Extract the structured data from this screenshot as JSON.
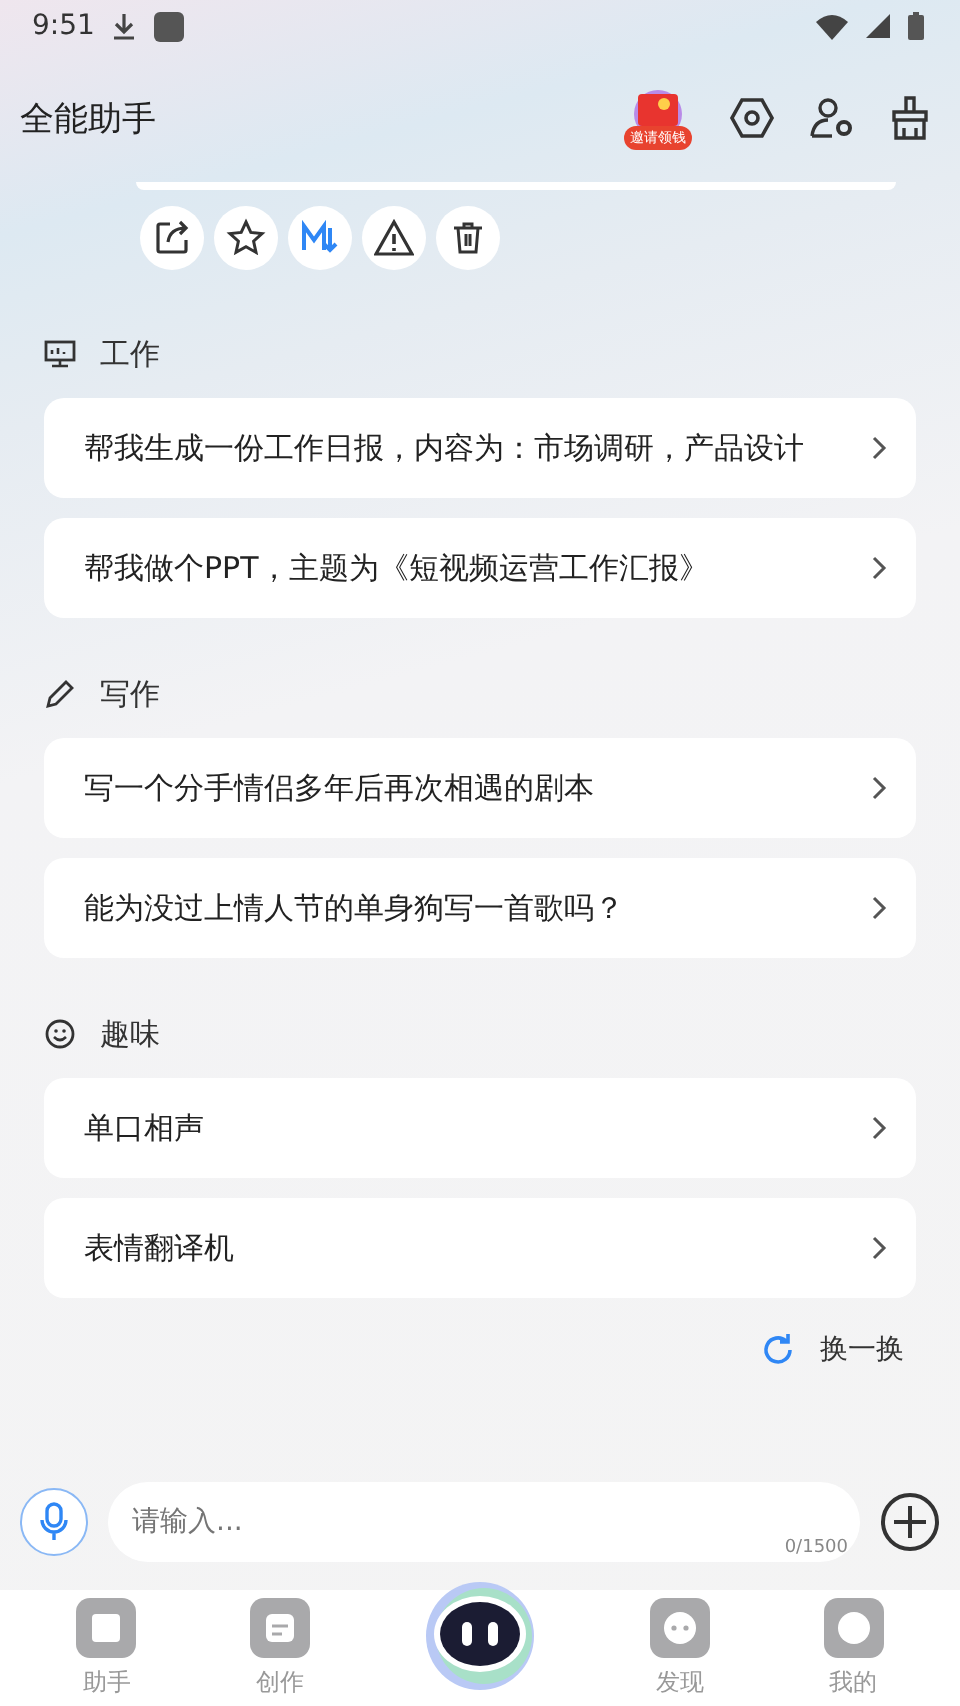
{
  "status_bar": {
    "time": "9:51"
  },
  "header": {
    "title": "全能助手",
    "badge": "邀请领钱"
  },
  "sections": [
    {
      "kind": "monitor",
      "title": "工作",
      "prompts": [
        "帮我生成一份工作日报，内容为：市场调研，产品设计",
        "帮我做个PPT，主题为《短视频运营工作汇报》"
      ]
    },
    {
      "kind": "pencil",
      "title": "写作",
      "prompts": [
        "写一个分手情侣多年后再次相遇的剧本",
        "能为没过上情人节的单身狗写一首歌吗？"
      ]
    },
    {
      "kind": "smile",
      "title": "趣味",
      "prompts": [
        "单口相声",
        "表情翻译机"
      ]
    }
  ],
  "refresh": "换一换",
  "input": {
    "placeholder": "请输入...",
    "counter": "0/1500"
  },
  "tabs": [
    {
      "label": "助手",
      "kind": "book"
    },
    {
      "label": "创作",
      "kind": "note"
    },
    {
      "label": "发现",
      "kind": "chat"
    },
    {
      "label": "我的",
      "kind": "face"
    }
  ]
}
